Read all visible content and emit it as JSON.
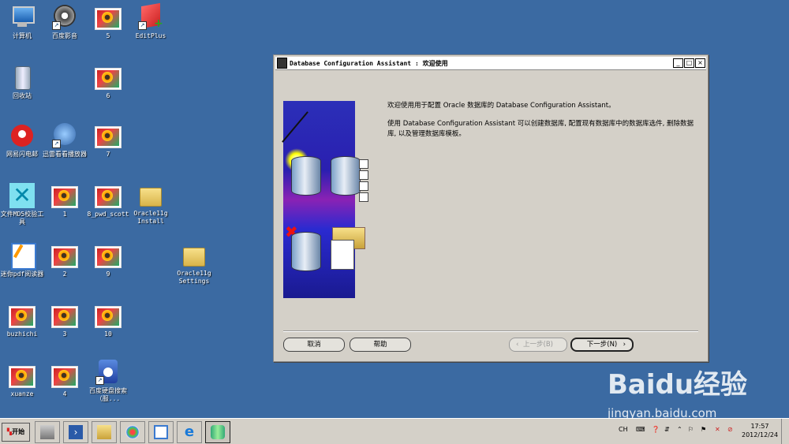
{
  "desktop": {
    "icons": [
      {
        "label": "计算机"
      },
      {
        "label": "百度影音"
      },
      {
        "label": "5"
      },
      {
        "label": "EditPlus"
      },
      {
        "label": "回收站"
      },
      {
        "label": "6"
      },
      {
        "label": "网易闪电邮"
      },
      {
        "label": "迅雷看看播放器"
      },
      {
        "label": "7"
      },
      {
        "label": "文件MD5校验工具"
      },
      {
        "label": "1"
      },
      {
        "label": "8_pwd_scott"
      },
      {
        "label": "Oracle11g Install"
      },
      {
        "label": "迷你pdf阅读器"
      },
      {
        "label": "2"
      },
      {
        "label": "9"
      },
      {
        "label": "Oracle11g Settings"
      },
      {
        "label": "buzhichi"
      },
      {
        "label": "3"
      },
      {
        "label": "10"
      },
      {
        "label": "xuanze"
      },
      {
        "label": "4"
      },
      {
        "label": "百度硬盘搜索（服..."
      }
    ]
  },
  "dialog": {
    "title": "Database Configuration Assistant : 欢迎使用",
    "welcome": "欢迎使用用于配置 Oracle 数据库的 Database Configuration Assistant。",
    "description": "使用 Database Configuration Assistant 可以创建数据库, 配置现有数据库中的数据库选件, 删除数据库, 以及管理数据库模板。",
    "buttons": {
      "cancel": "取消",
      "help": "帮助",
      "back": "上一步(B)",
      "next": "下一步(N)"
    },
    "window_controls": {
      "minimize": "_",
      "maximize": "□",
      "close": "×"
    }
  },
  "taskbar": {
    "start_label": "开始",
    "lang": "CH",
    "clock_time": "17:57",
    "clock_date": "2012/12/24"
  },
  "watermark": {
    "brand": "Baidu经验",
    "url": "jingyan.baidu.com"
  }
}
